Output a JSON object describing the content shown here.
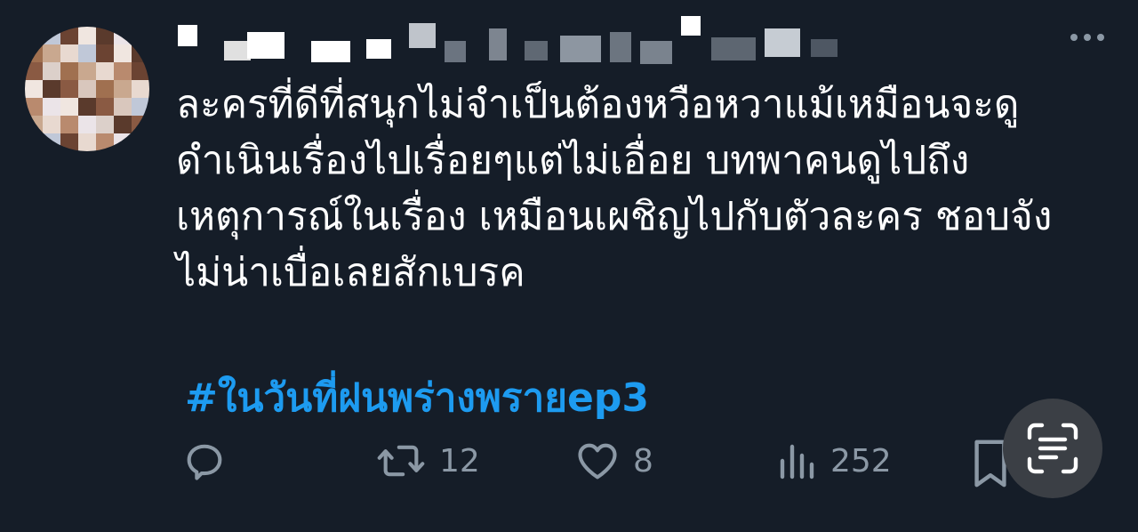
{
  "tweet": {
    "body_lines": [
      "ละครที่ดีที่สนุกไม่จำเป็นต้องหวือหวาแม้เหมือนจะดู",
      "ดำเนินเรื่องไปเรื่อยๆแต่ไม่เอื่อย บทพาคนดูไปถึง",
      "เหตุการณ์ในเรื่อง เหมือนเผชิญไปกับตัวละคร ชอบจัง",
      "ไม่น่าเบื่อเลยสักเบรค"
    ],
    "hashtag": "#ในวันที่ฝนพร่างพรายep3"
  },
  "actions": {
    "retweet_count": "12",
    "like_count": "8",
    "view_count": "252"
  },
  "icons": {
    "reply": "reply-icon",
    "retweet": "retweet-icon",
    "like": "heart-icon",
    "views": "views-icon",
    "bookmark": "bookmark-icon",
    "more": "more-icon",
    "scan": "scan-text-icon"
  },
  "colors": {
    "background": "#151d28",
    "text": "#ffffff",
    "muted": "#8b98a5",
    "accent": "#1d9bf0"
  }
}
